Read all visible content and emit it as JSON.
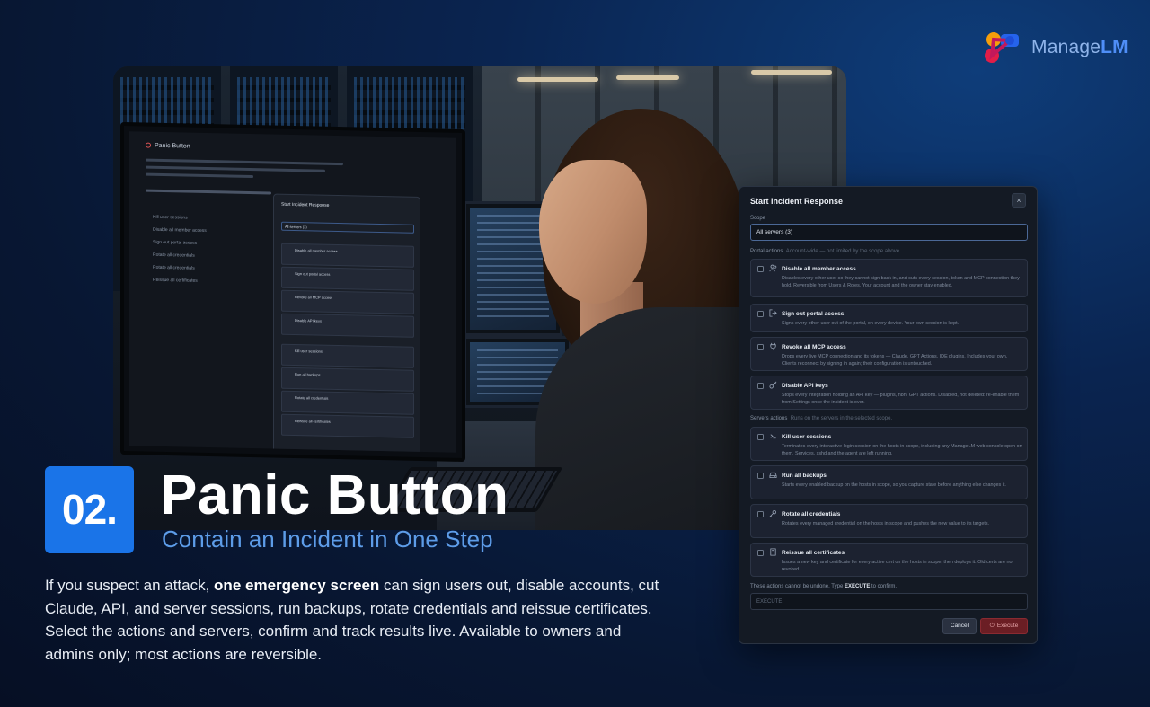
{
  "brand": {
    "name_part1": "Manage",
    "name_part2": "LM",
    "primary_color": "#1a74e8",
    "logo_colors": [
      "#f59e0b",
      "#e11d48",
      "#2563eb"
    ]
  },
  "monitor_screen": {
    "title": "Panic Button",
    "items": [
      "Kill user sessions",
      "Disable all member access",
      "Sign out portal access",
      "Rotate all credentials",
      "Rotate all credentials",
      "Reissue all certificates"
    ],
    "modal_title": "Start Incident Response",
    "modal_scope": "All servers (3)",
    "modal_cards": [
      "Disable all member access",
      "Sign out portal access",
      "Revoke all MCP access",
      "Disable API keys",
      "Kill user sessions",
      "Run all backups",
      "Rotate all credentials",
      "Reissue all certificates"
    ]
  },
  "dialog": {
    "title": "Start Incident Response",
    "close_symbol": "×",
    "scope_label": "Scope",
    "scope_value": "All servers (3)",
    "portal_label": "Portal actions",
    "portal_hint": "Account-wide — not limited by the scope above.",
    "portal_actions": [
      {
        "icon": "users-icon",
        "title": "Disable all member access",
        "desc": "Disables every other user so they cannot sign back in, and cuts every session, token and MCP connection they hold. Reversible from Users & Roles. Your account and the owner stay enabled."
      },
      {
        "icon": "sign-out-icon",
        "title": "Sign out portal access",
        "desc": "Signs every other user out of the portal, on every device. Your own session is kept."
      },
      {
        "icon": "plug-icon",
        "title": "Revoke all MCP access",
        "desc": "Drops every live MCP connection and its tokens — Claude, GPT Actions, IDE plugins. Includes your own. Clients reconnect by signing in again; their configuration is untouched."
      },
      {
        "icon": "key-icon",
        "title": "Disable API keys",
        "desc": "Stops every integration holding an API key — plugins, n8n, GPT actions. Disabled, not deleted: re-enable them from Settings once the incident is over."
      }
    ],
    "server_label": "Servers actions",
    "server_hint": "Runs on the servers in the selected scope.",
    "server_actions": [
      {
        "icon": "terminal-icon",
        "title": "Kill user sessions",
        "desc": "Terminates every interactive login session on the hosts in scope, including any ManageLM web console open on them. Services, sshd and the agent are left running."
      },
      {
        "icon": "drive-icon",
        "title": "Run all backups",
        "desc": "Starts every enabled backup on the hosts in scope, so you capture state before anything else changes it."
      },
      {
        "icon": "key-rotate-icon",
        "title": "Rotate all credentials",
        "desc": "Rotates every managed credential on the hosts in scope and pushes the new value to its targets."
      },
      {
        "icon": "certificate-icon",
        "title": "Reissue all certificates",
        "desc": "Issues a new key and certificate for every active cert on the hosts in scope, then deploys it. Old certs are not revoked."
      }
    ],
    "confirm_prefix": "These actions cannot be undone. Type",
    "confirm_word": "EXECUTE",
    "confirm_suffix": "to confirm.",
    "confirm_placeholder": "EXECUTE",
    "cancel_label": "Cancel",
    "execute_label": "Execute"
  },
  "headline": {
    "number": "02.",
    "title": "Panic Button",
    "subtitle": "Contain an Incident in One Step"
  },
  "body": {
    "part1": "If you suspect an attack, ",
    "bold": "one emergency screen",
    "part2": " can sign users out, disable accounts, cut Claude, API, and server sessions, run backups, rotate credentials and reissue certificates. Select the actions and servers, confirm and track results live. Available to owners and admins only; most actions are reversible."
  }
}
